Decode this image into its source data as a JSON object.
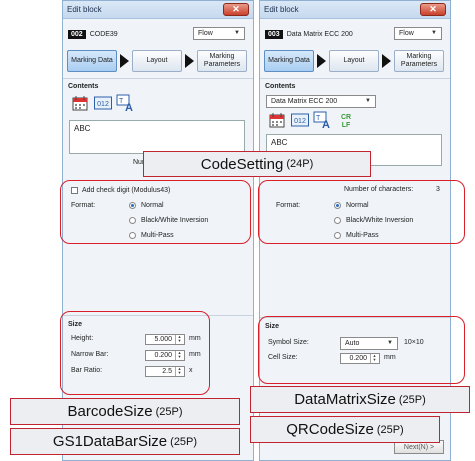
{
  "left_window": {
    "title": "Edit block",
    "block_number": "002",
    "block_name": "CODE39",
    "mode_select": "Flow",
    "tabs": [
      "Marking Data",
      "Layout",
      "Marking\nParameters"
    ],
    "contents_label": "Contents",
    "text_value": "ABC",
    "num_partial": "Num",
    "check_digit_label": "Add check digit (Modulus43)",
    "format_label": "Format:",
    "format_options": [
      "Normal",
      "Black/White Inversion",
      "Multi-Pass"
    ],
    "format_selected": 0,
    "size_label": "Size",
    "size_rows": [
      {
        "label": "Height:",
        "value": "5.000",
        "unit": "mm"
      },
      {
        "label": "Narrow Bar:",
        "value": "0.200",
        "unit": "mm"
      },
      {
        "label": "Bar Ratio:",
        "value": "2.5",
        "unit": "x"
      }
    ]
  },
  "right_window": {
    "title": "Edit block",
    "block_number": "003",
    "block_name": "Data Matrix ECC 200",
    "mode_select": "Flow",
    "tabs": [
      "Marking Data",
      "Layout",
      "Marking\nParameters"
    ],
    "contents_label": "Contents",
    "code_type_select": "Data Matrix ECC 200",
    "text_value": "ABC",
    "num_chars_label": "Number of characters:",
    "num_chars_value": "3",
    "format_label": "Format:",
    "format_options": [
      "Normal",
      "Black/White Inversion",
      "Multi-Pass"
    ],
    "format_selected": 0,
    "size_label": "Size",
    "symbol_size_label": "Symbol Size:",
    "symbol_size_value": "Auto",
    "symbol_size_dims": "10×10",
    "cell_size_label": "Cell Size:",
    "cell_size_value": "0.200",
    "cell_size_unit": "mm",
    "next_button": "Next(N) >"
  },
  "callouts": {
    "code_setting": {
      "main": "CodeSetting",
      "pages": "(24P)"
    },
    "barcode_size": {
      "main": "BarcodeSize",
      "pages": "(25P)"
    },
    "gs1_size": {
      "main": "GS1DataBarSize",
      "pages": "(25P)"
    },
    "datamatrix_size": {
      "main": "DataMatrixSize",
      "pages": "(25P)"
    },
    "qrcode_size": {
      "main": "QRCodeSize",
      "pages": "(25P)"
    }
  },
  "colors": {
    "highlight": "#d81f2a",
    "tab_active": "#a9cdf1"
  },
  "icons": [
    "calendar-icon",
    "counter-icon",
    "font-icon",
    "crlf-icon"
  ]
}
